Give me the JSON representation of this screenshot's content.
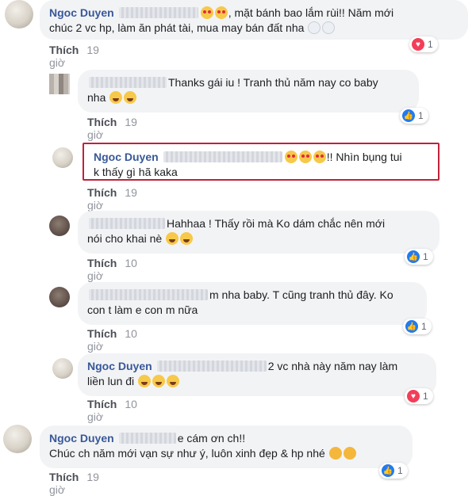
{
  "comments": [
    {
      "author": "Ngoc Duyen",
      "text_after": ", mặt bánh bao lắm rùi!! Năm mới",
      "text_line2": "chúc 2 vc hp, làm ăn phát tài, mua may bán đất nha",
      "like_label": "Thích",
      "time": "19 giờ",
      "reaction": {
        "icon": "love-reaction-icon",
        "count": "1"
      }
    },
    {
      "text": "Thanks gái iu ! Tranh thủ năm nay co baby",
      "text_line2": "nha",
      "like_label": "Thích",
      "time": "19 giờ",
      "reaction": {
        "icon": "like-reaction-icon",
        "count": "1"
      }
    },
    {
      "author": "Ngoc Duyen",
      "text_after": "!! Nhìn bụng tui",
      "text_line2": "k thấy gì hã kaka",
      "like_label": "Thích",
      "time": "19 giờ"
    },
    {
      "text": "Hahhaa ! Thấy rồi mà Ko dám chắc nên mới",
      "text_line2": "nói cho khai nè",
      "like_label": "Thích",
      "time": "10 giờ",
      "reaction": {
        "icon": "like-reaction-icon",
        "count": "1"
      }
    },
    {
      "text": "m nha baby. T cũng tranh thủ đây. Ko",
      "text_line2": "con t làm e con m nữa",
      "like_label": "Thích",
      "time": "10 giờ",
      "reaction": {
        "icon": "like-reaction-icon",
        "count": "1"
      }
    },
    {
      "author": "Ngoc Duyen",
      "text_after": "2 vc nhà này năm nay làm",
      "text_line2": "liền lun đi",
      "like_label": "Thích",
      "time": "10 giờ",
      "reaction": {
        "icon": "love-reaction-icon",
        "count": "1"
      }
    },
    {
      "author": "Ngoc Duyen",
      "text_after": "e cám ơn ch!!",
      "text_line2": "Chúc ch năm mới vạn sự như ý, luôn xinh đẹp & hp nhé",
      "like_label": "Thích",
      "time": "19 giờ",
      "reaction": {
        "icon": "like-reaction-icon",
        "count": "1"
      }
    }
  ],
  "colors": {
    "name": "#385898",
    "highlight_border": "#c0213b",
    "bubble": "#f2f3f5",
    "love": "#f33e58",
    "like": "#1f7bf2"
  }
}
